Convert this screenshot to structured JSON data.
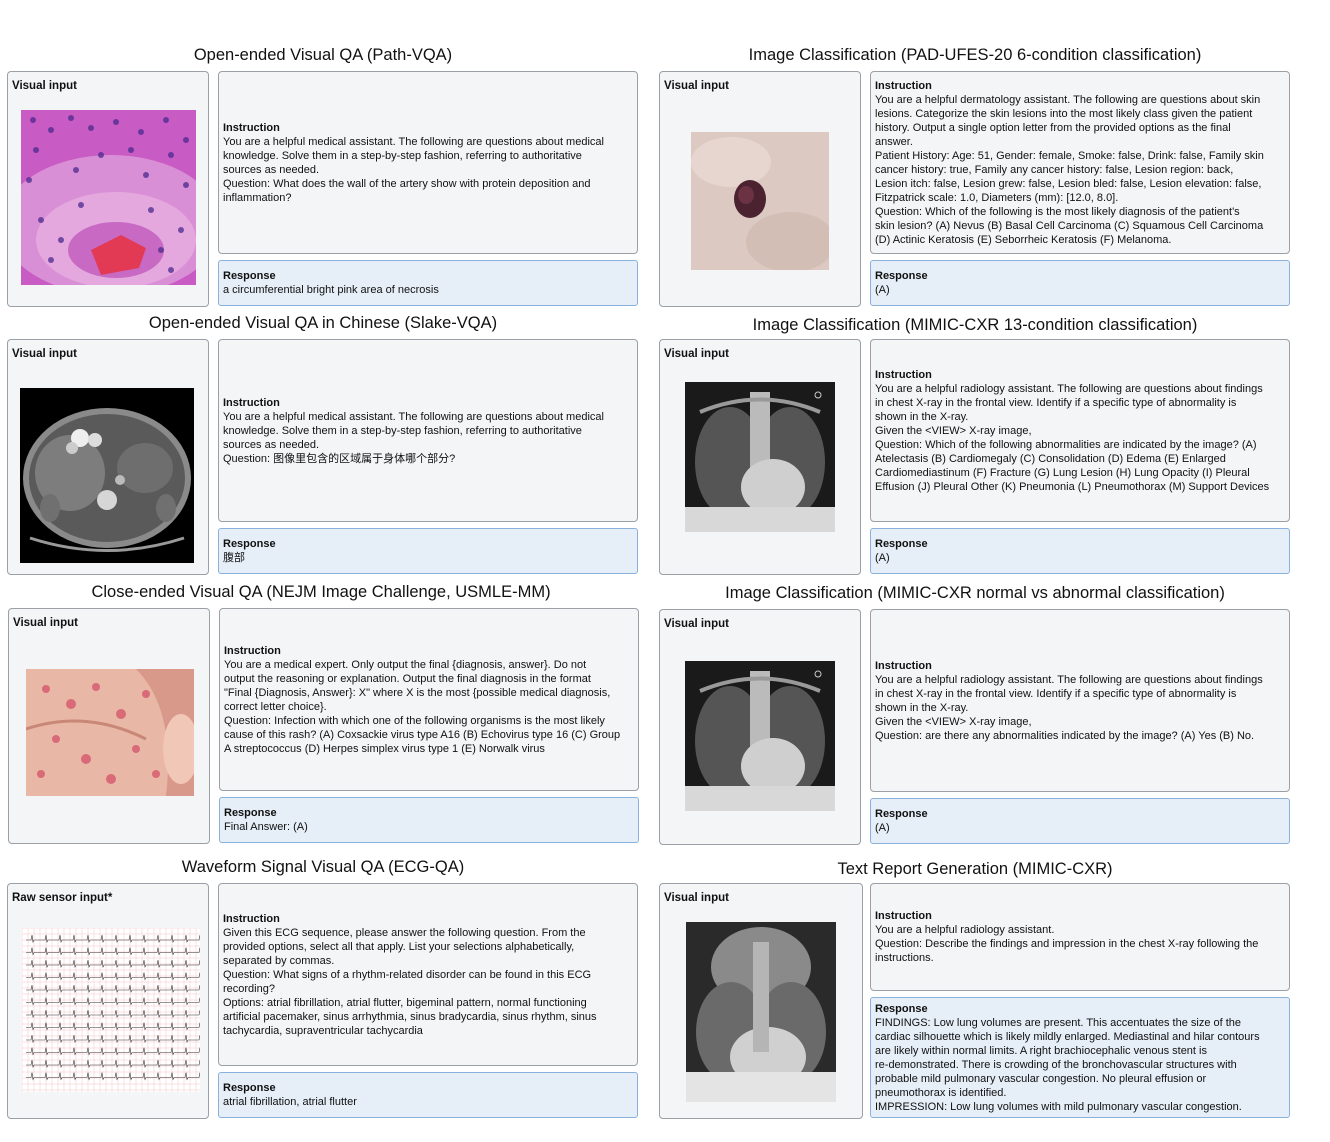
{
  "panels": [
    {
      "title": "Open-ended Visual QA (Path-VQA)",
      "input_label": "Visual input",
      "instruction_header": "Instruction",
      "instruction": "You are a helpful medical assistant. The following are questions about medical\nknowledge. Solve them in a step-by-step fashion, referring to authoritative\nsources as needed.\nQuestion: What does the wall of the artery show with protein deposition and\ninflammation?",
      "response_header": "Response",
      "response": "a circumferential bright pink area of necrosis",
      "image": "pathology-histology-image"
    },
    {
      "title": "Image Classification (PAD-UFES-20 6-condition classification)",
      "input_label": "Visual input",
      "instruction_header": "Instruction",
      "instruction": "You are a helpful dermatology assistant. The following are questions about skin\nlesions. Categorize the skin lesions into the most likely class given the patient\nhistory. Output a single option letter from the provided options as the final\nanswer.\nPatient History: Age: 51, Gender: female, Smoke: false, Drink: false, Family skin\ncancer history: true, Family any cancer history: false, Lesion region: back,\nLesion itch: false, Lesion grew: false, Lesion bled: false, Lesion elevation: false,\nFitzpatrick scale: 1.0, Diameters (mm): [12.0, 8.0].\nQuestion: Which of the following is the most likely diagnosis of the patient's\nskin lesion? (A) Nevus (B) Basal Cell Carcinoma (C) Squamous Cell Carcinoma\n(D) Actinic Keratosis (E) Seborrheic Keratosis (F) Melanoma.",
      "response_header": "Response",
      "response": "(A)",
      "image": "skin-lesion-photo"
    },
    {
      "title": "Open-ended Visual QA in Chinese  (Slake-VQA)",
      "input_label": "Visual input",
      "instruction_header": "Instruction",
      "instruction": "You are a helpful medical assistant. The following are questions about medical\nknowledge. Solve them in a step-by-step fashion, referring to authoritative\nsources as needed.\nQuestion: 图像里包含的区域属于身体哪个部分?",
      "response_header": "Response",
      "response": "腹部",
      "image": "abdominal-ct-scan"
    },
    {
      "title": "Image Classification (MIMIC-CXR 13-condition classification)",
      "input_label": "Visual input",
      "instruction_header": "Instruction",
      "instruction": "You are a helpful radiology assistant. The following are questions about findings\nin chest X-ray in the frontal view. Identify if a specific type of abnormality is\nshown in the X-ray.\nGiven the <VIEW> X-ray image,\nQuestion: Which of the following abnormalities are indicated by the image? (A)\nAtelectasis (B) Cardiomegaly (C) Consolidation (D) Edema (E) Enlarged\nCardiomediastinum (F) Fracture (G) Lung Lesion (H) Lung Opacity (I) Pleural\nEffusion (J) Pleural Other (K) Pneumonia (L) Pneumothorax (M) Support Devices",
      "response_header": "Response",
      "response": "(A)",
      "image": "chest-xray"
    },
    {
      "title": "Close-ended Visual QA (NEJM Image Challenge, USMLE-MM)",
      "input_label": "Visual input",
      "instruction_header": "Instruction",
      "instruction": "You are a medical expert. Only output the final {diagnosis, answer}. Do not\noutput the reasoning or explanation. Output the final diagnosis in the format\n\"Final {Diagnosis, Answer}: X\" where X is the most {possible medical diagnosis,\ncorrect letter choice}.\nQuestion: Infection with which one of the following organisms is the most likely\ncause of this rash? (A) Coxsackie virus type A16 (B) Echovirus type 16 (C) Group\nA streptococcus (D) Herpes simplex virus type 1 (E) Norwalk virus",
      "response_header": "Response",
      "response": "Final Answer: (A)",
      "image": "hand-rash-photo"
    },
    {
      "title": "Image Classification (MIMIC-CXR normal vs abnormal classification)",
      "input_label": "Visual input",
      "instruction_header": "Instruction",
      "instruction": "You are a helpful radiology assistant. The following are questions about findings\nin chest X-ray in the frontal view. Identify if a specific type of abnormality is\nshown in the X-ray.\nGiven the <VIEW> X-ray image,\nQuestion: are there any abnormalities indicated by the image? (A) Yes (B) No.",
      "response_header": "Response",
      "response": "(A)",
      "image": "chest-xray"
    },
    {
      "title": "Waveform Signal Visual QA (ECG-QA)",
      "input_label": "Raw sensor input*",
      "instruction_header": "Instruction",
      "instruction": "Given this ECG sequence, please answer the following question. From the\nprovided options, select all that apply. List your selections alphabetically,\nseparated by commas.\nQuestion: What signs of a rhythm-related disorder can be found in this ECG\nrecording?\nOptions: atrial fibrillation, atrial flutter, bigeminal pattern, normal functioning\nartificial pacemaker, sinus arrhythmia, sinus bradycardia, sinus rhythm, sinus\ntachycardia, supraventricular tachycardia",
      "response_header": "Response",
      "response": "atrial fibrillation, atrial flutter",
      "image": "ecg-tracing"
    },
    {
      "title": "Text Report Generation (MIMIC-CXR)",
      "input_label": "Visual input",
      "instruction_header": "Instruction",
      "instruction": "You are a helpful radiology assistant.\nQuestion: Describe the findings and impression in the chest X-ray following the\ninstructions.",
      "response_header": "Response",
      "response": "FINDINGS: Low lung volumes are present. This accentuates the size of the\ncardiac silhouette which is likely mildly enlarged. Mediastinal and hilar contours\nare likely within normal limits. A right brachiocephalic venous stent is\nre-demonstrated. There is crowding of the bronchovascular structures with\nprobable mild pulmonary vascular congestion. No pleural effusion or\npneumothorax is identified.\nIMPRESSION: Low lung volumes with mild pulmonary vascular congestion.",
      "image": "chest-xray"
    }
  ]
}
